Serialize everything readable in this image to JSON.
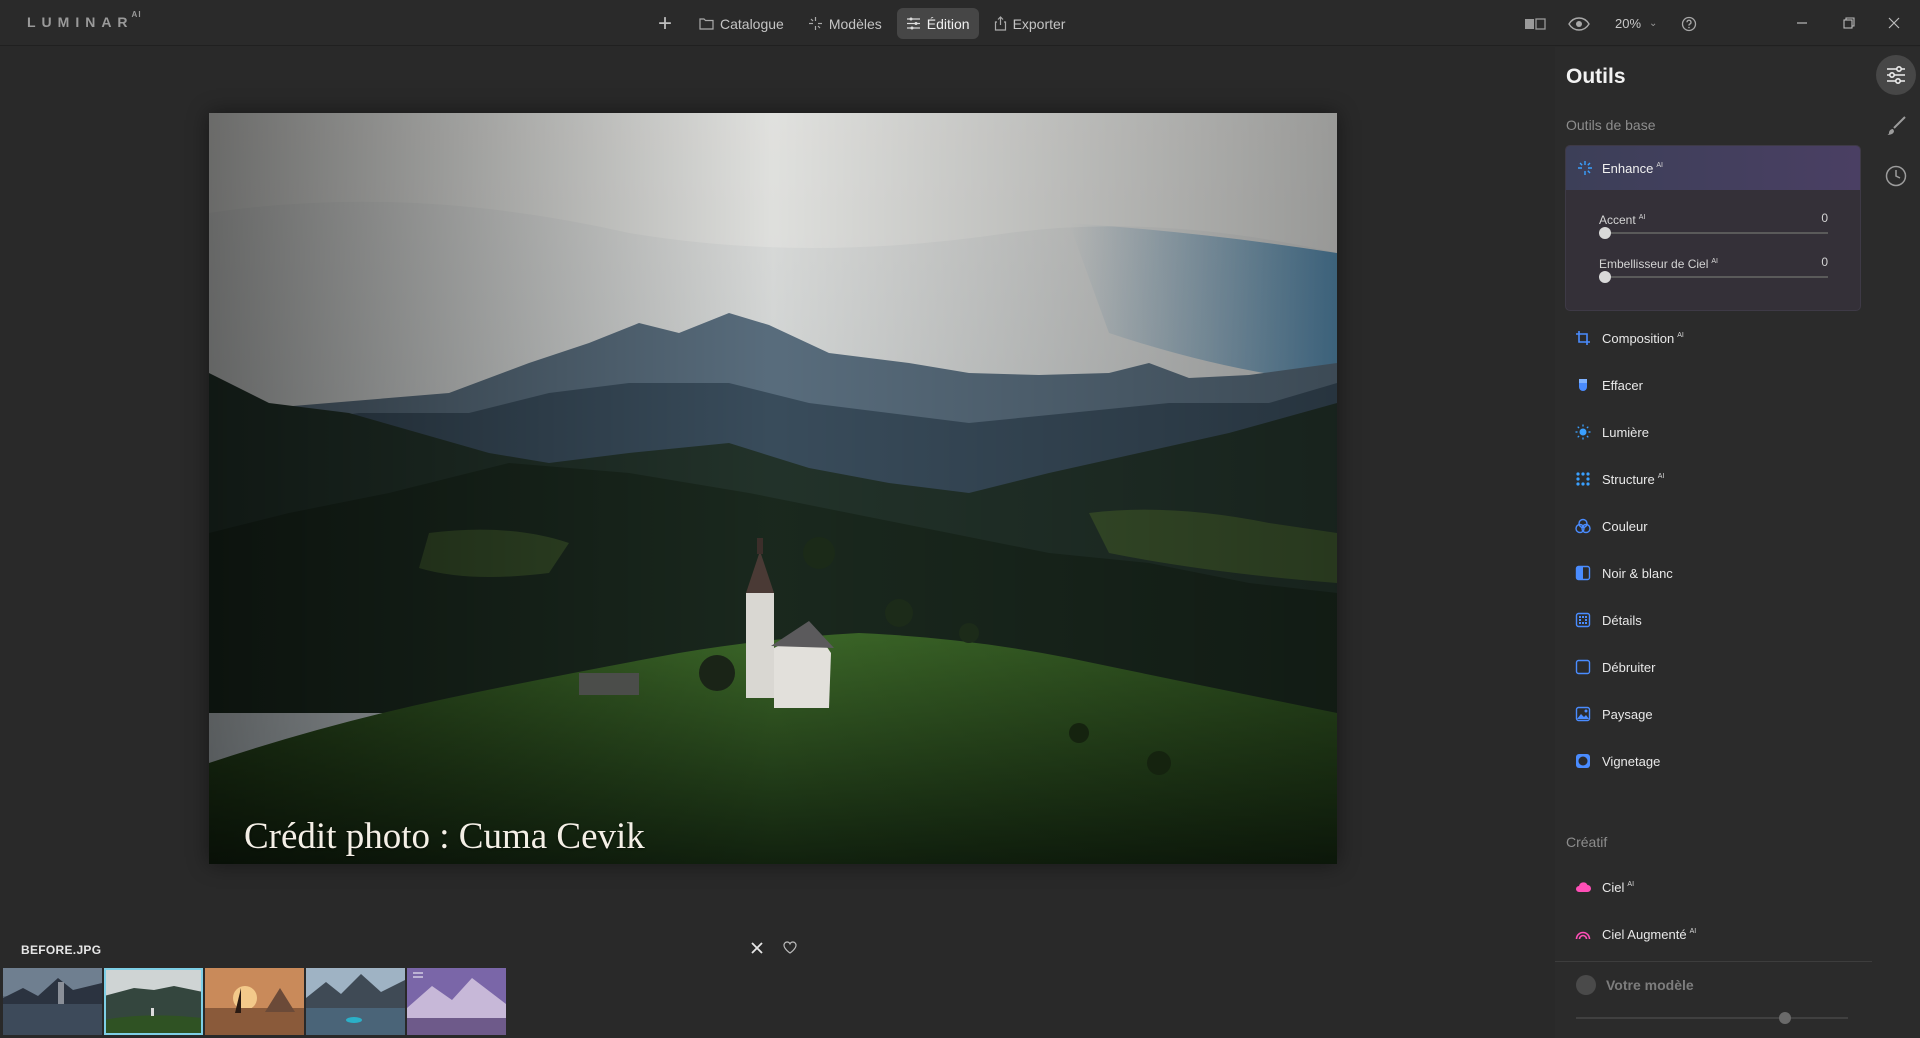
{
  "app": {
    "logo_text": "LUMINAR",
    "logo_sup": "AI"
  },
  "nav": {
    "items": [
      {
        "label": "Catalogue",
        "icon": "folder-icon"
      },
      {
        "label": "Modèles",
        "icon": "sparkle-icon"
      },
      {
        "label": "Édition",
        "icon": "sliders-icon",
        "active": true
      },
      {
        "label": "Exporter",
        "icon": "share-icon"
      }
    ]
  },
  "toolbar": {
    "zoom": "20%"
  },
  "photo": {
    "credit": "Crédit photo : Cuma Cevik"
  },
  "filmstrip": {
    "filename": "BEFORE.JPG",
    "selected_index": 1,
    "thumb_count": 5
  },
  "panel": {
    "title": "Outils",
    "basic_label": "Outils de base",
    "enhance": {
      "label": "Enhance",
      "ai": "AI",
      "sliders": [
        {
          "name": "Accent",
          "ai": "AI",
          "value": "0"
        },
        {
          "name": "Embellisseur de Ciel",
          "ai": "AI",
          "value": "0"
        }
      ]
    },
    "tools": [
      {
        "label": "Composition",
        "ai": "AI",
        "icon": "crop-icon"
      },
      {
        "label": "Effacer",
        "ai": "",
        "icon": "eraser-icon"
      },
      {
        "label": "Lumière",
        "ai": "",
        "icon": "sun-icon"
      },
      {
        "label": "Structure",
        "ai": "AI",
        "icon": "structure-icon"
      },
      {
        "label": "Couleur",
        "ai": "",
        "icon": "color-icon"
      },
      {
        "label": "Noir & blanc",
        "ai": "",
        "icon": "black-white-icon"
      },
      {
        "label": "Détails",
        "ai": "",
        "icon": "details-icon"
      },
      {
        "label": "Débruiter",
        "ai": "",
        "icon": "denoise-icon"
      },
      {
        "label": "Paysage",
        "ai": "",
        "icon": "landscape-icon"
      },
      {
        "label": "Vignetage",
        "ai": "",
        "icon": "vignette-icon"
      }
    ],
    "creative_label": "Créatif",
    "creative_tools": [
      {
        "label": "Ciel",
        "ai": "AI",
        "icon": "cloud-icon"
      },
      {
        "label": "Ciel Augmenté",
        "ai": "AI",
        "icon": "augmented-sky-icon"
      }
    ],
    "model_label": "Votre modèle",
    "model_amount": 0.78
  },
  "colors": {
    "accent_blue": "#3aa0ff",
    "tool_blue": "#4a8cff",
    "creative_pink": "#ff4fb7",
    "selection_outline": "#7ecfe6"
  }
}
